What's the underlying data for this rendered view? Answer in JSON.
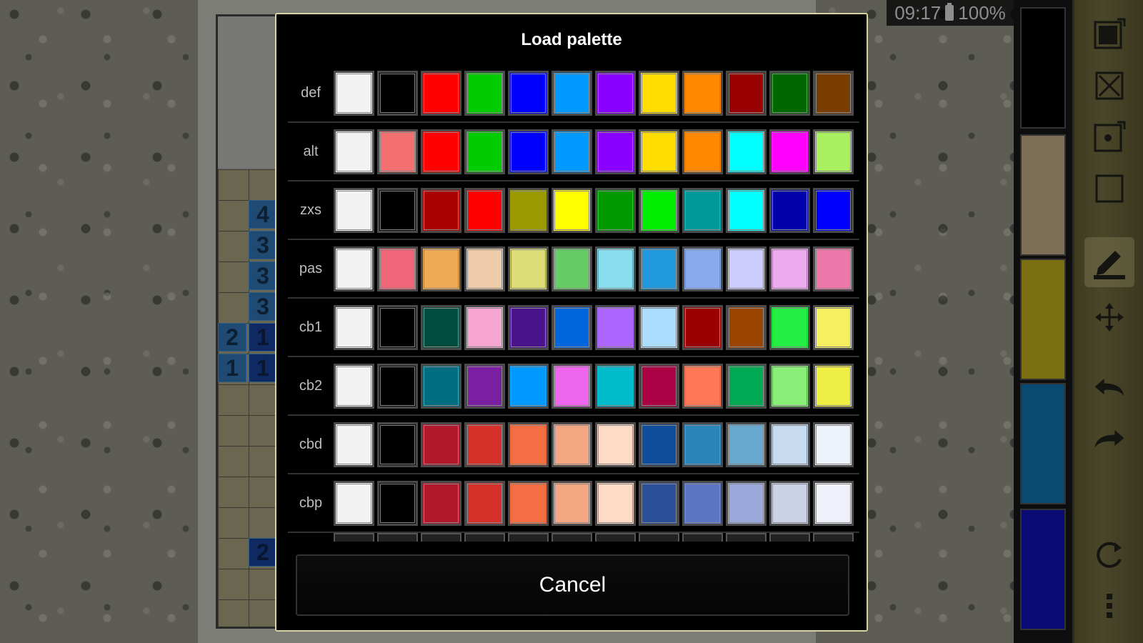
{
  "status": {
    "time": "09:17",
    "battery": "100%"
  },
  "board": {
    "clues": [
      {
        "text": "4",
        "col": 1,
        "row": 0,
        "dark": false
      },
      {
        "text": "3",
        "col": 1,
        "row": 1,
        "dark": false
      },
      {
        "text": "3",
        "col": 1,
        "row": 2,
        "dark": false
      },
      {
        "text": "3",
        "col": 1,
        "row": 3,
        "dark": false
      },
      {
        "text": "2",
        "col": 0,
        "row": 4,
        "dark": false
      },
      {
        "text": "1",
        "col": 1,
        "row": 4,
        "dark": true
      },
      {
        "text": "1",
        "col": 0,
        "row": 5,
        "dark": false
      },
      {
        "text": "1",
        "col": 1,
        "row": 5,
        "dark": true
      },
      {
        "text": "2",
        "col": 1,
        "row": 11,
        "dark": true
      }
    ]
  },
  "side_palette": [
    "#000000",
    "#7d6e55",
    "#7a6e10",
    "#0a4a70",
    "#0b0b75"
  ],
  "toolbar": {
    "tools": [
      "fill-square-icon",
      "cross-icon",
      "dot-icon",
      "empty-square-icon",
      "pencil-ruler-icon",
      "move-icon",
      "undo-icon",
      "redo-icon",
      "refresh-icon",
      "more-icon"
    ]
  },
  "dialog": {
    "title": "Load palette",
    "cancel_label": "Cancel",
    "palettes": [
      {
        "name": "def",
        "colors": [
          "#f2f2f2",
          "#000000",
          "#ff0000",
          "#00cc00",
          "#0000ff",
          "#0099ff",
          "#8800ff",
          "#ffdd00",
          "#ff8800",
          "#990000",
          "#006600",
          "#7a3d00"
        ]
      },
      {
        "name": "alt",
        "colors": [
          "#f2f2f2",
          "#f27070",
          "#ff0000",
          "#00cc00",
          "#0000ff",
          "#0099ff",
          "#8800ff",
          "#ffdd00",
          "#ff8800",
          "#00ffff",
          "#ff00ff",
          "#a8f060"
        ]
      },
      {
        "name": "zxs",
        "colors": [
          "#f2f2f2",
          "#000000",
          "#aa0000",
          "#ff0000",
          "#9a9a00",
          "#ffff00",
          "#009900",
          "#00ee00",
          "#009999",
          "#00ffff",
          "#0000aa",
          "#0000ff"
        ]
      },
      {
        "name": "pas",
        "colors": [
          "#f2f2f2",
          "#ee6677",
          "#eeaa55",
          "#eeccaa",
          "#dddd77",
          "#66cc66",
          "#88ddee",
          "#2299dd",
          "#88aaee",
          "#ccccff",
          "#eeaaee",
          "#ee77aa"
        ]
      },
      {
        "name": "cb1",
        "colors": [
          "#f2f2f2",
          "#000000",
          "#004d40",
          "#f6a5d0",
          "#4a148c",
          "#0066dd",
          "#aa66ff",
          "#aaddff",
          "#990000",
          "#994400",
          "#22ee44",
          "#f6f060"
        ]
      },
      {
        "name": "cb2",
        "colors": [
          "#f2f2f2",
          "#000000",
          "#006d80",
          "#7a1fa2",
          "#0099ff",
          "#ee66ee",
          "#00bbcc",
          "#aa0044",
          "#ff7755",
          "#00aa55",
          "#88ee77",
          "#eeee44"
        ]
      },
      {
        "name": "cbd",
        "colors": [
          "#f2f2f2",
          "#000000",
          "#b2182b",
          "#d6302a",
          "#f46d43",
          "#f4a582",
          "#fddbc7",
          "#0f4d9a",
          "#2b83ba",
          "#67a9cf",
          "#c6dbef",
          "#eef2fa"
        ]
      },
      {
        "name": "cbp",
        "colors": [
          "#f2f2f2",
          "#000000",
          "#b2182b",
          "#d6302a",
          "#f46d43",
          "#f4a582",
          "#fddbc7",
          "#2c4f9a",
          "#5b75c4",
          "#9aa8dc",
          "#ccd2e6",
          "#eef0fa"
        ]
      }
    ]
  }
}
